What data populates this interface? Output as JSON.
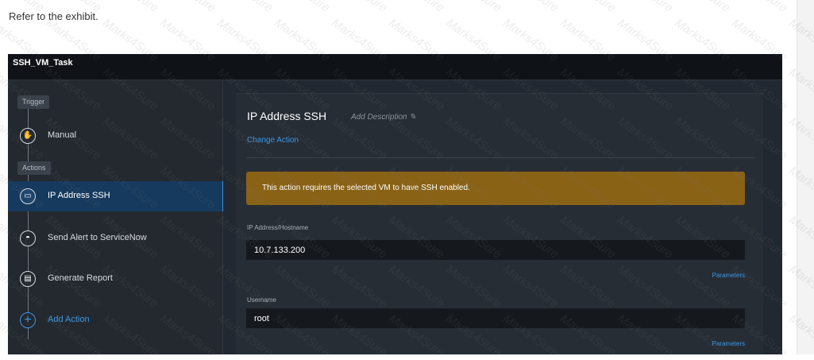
{
  "intro_text": "Refer to the exhibit.",
  "window": {
    "title": "SSH_VM_Task"
  },
  "sidebar": {
    "trigger_label": "Trigger",
    "actions_label": "Actions",
    "steps": [
      {
        "label": "Manual",
        "icon": "hand-icon"
      },
      {
        "label": "IP Address SSH",
        "icon": "terminal-icon",
        "active": true
      },
      {
        "label": "Send Alert to ServiceNow",
        "icon": "servicenow-icon"
      },
      {
        "label": "Generate Report",
        "icon": "report-icon"
      },
      {
        "label": "Add Action",
        "icon": "plus-icon"
      }
    ]
  },
  "main": {
    "action_title": "IP Address SSH",
    "add_description": "Add Description",
    "change_action": "Change Action",
    "warning": "This action requires the selected VM to have SSH enabled.",
    "fields": [
      {
        "label": "IP Address/Hostname",
        "value": "10.7.133.200",
        "parameters_link": "Parameters"
      },
      {
        "label": "Username",
        "value": "root",
        "parameters_link": "Parameters"
      }
    ]
  },
  "watermark": "Marks4Sure",
  "colors": {
    "accent": "#3b97e3",
    "warning": "#8a6216",
    "active_step": "#163a5e"
  }
}
